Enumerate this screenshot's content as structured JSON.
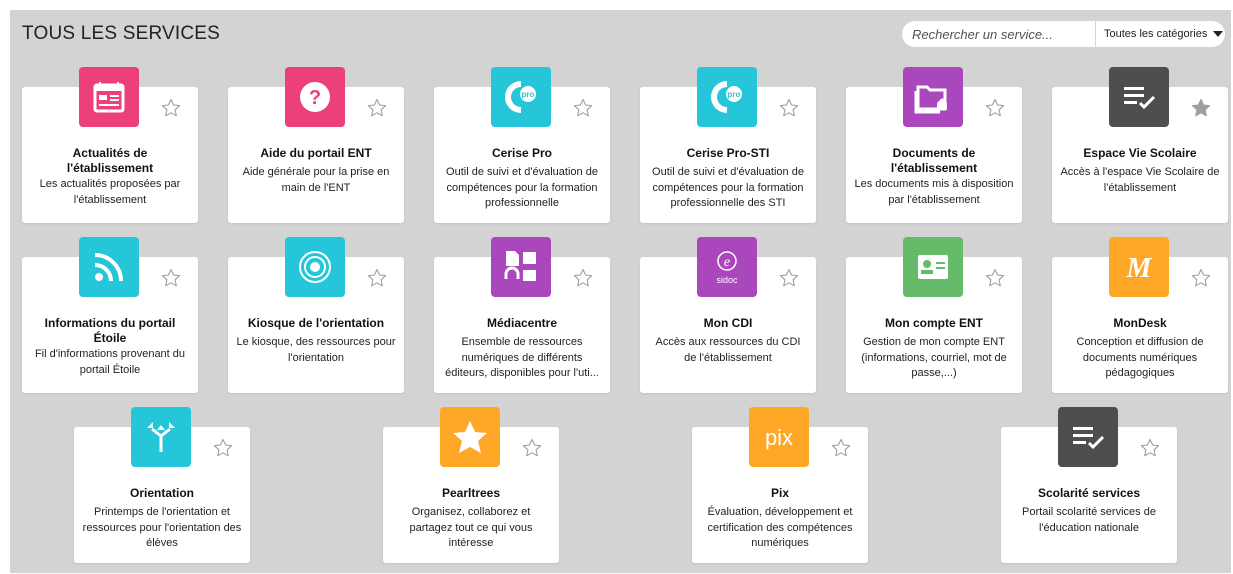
{
  "page": {
    "title": "TOUS LES SERVICES"
  },
  "search": {
    "placeholder": "Rechercher un service...",
    "category_label": "Toutes les catégories"
  },
  "colors": {
    "pink": "#ec407a",
    "cyan": "#26c6da",
    "purple": "#ab47bc",
    "dark": "#4e4e4e",
    "green": "#66bb6a",
    "orange": "#ffa726",
    "star_outline": "#9e9e9e",
    "star_filled": "#9e9e9e"
  },
  "services": [
    {
      "title": "Actualités de l'établissement",
      "description": "Les actualités proposées par l'établissement",
      "icon": "newspaper-icon",
      "color": "#ec407a",
      "favorite": false
    },
    {
      "title": "Aide du portail ENT",
      "description": "Aide générale pour la prise en main de l'ENT",
      "icon": "help-icon",
      "color": "#ec407a",
      "favorite": false
    },
    {
      "title": "Cerise Pro",
      "description": "Outil de suivi et d'évaluation de compétences pour la formation professionnelle",
      "icon": "cerise-pro-icon",
      "color": "#26c6da",
      "favorite": false
    },
    {
      "title": "Cerise Pro-STI",
      "description": "Outil de suivi et d'évaluation de compétences pour la formation professionnelle des STI",
      "icon": "cerise-pro-icon",
      "color": "#26c6da",
      "favorite": false
    },
    {
      "title": "Documents de l'établissement",
      "description": "Les documents mis à disposition par l'établissement",
      "icon": "folder-home-icon",
      "color": "#ab47bc",
      "favorite": false
    },
    {
      "title": "Espace Vie Scolaire",
      "description": "Accès à l'espace Vie Scolaire de l'établissement",
      "icon": "checklist-icon",
      "color": "#4e4e4e",
      "favorite": true
    },
    {
      "title": "Informations du portail Étoile",
      "description": "Fil d'informations provenant du portail Étoile",
      "icon": "rss-icon",
      "color": "#26c6da",
      "favorite": false
    },
    {
      "title": "Kiosque de l'orientation",
      "description": "Le kiosque, des ressources pour l'orientation",
      "icon": "target-icon",
      "color": "#26c6da",
      "favorite": false
    },
    {
      "title": "Médiacentre",
      "description": "Ensemble de ressources numériques de différents éditeurs, disponibles pour l'uti...",
      "icon": "media-icon",
      "color": "#ab47bc",
      "favorite": false
    },
    {
      "title": "Mon CDI",
      "description": "Accès aux ressources du CDI de l'établissement",
      "icon": "sidoc-icon",
      "icon_text": "sidoc",
      "color": "#ab47bc",
      "favorite": false
    },
    {
      "title": "Mon compte ENT",
      "description": "Gestion de mon compte ENT (informations, courriel, mot de passe,...)",
      "icon": "id-card-icon",
      "color": "#66bb6a",
      "favorite": false
    },
    {
      "title": "MonDesk",
      "description": "Conception et diffusion de documents numériques pédagogiques",
      "icon": "mondesk-icon",
      "icon_text": "M",
      "color": "#ffa726",
      "favorite": false
    },
    {
      "title": "Orientation",
      "description": "Printemps de l'orientation et ressources pour l'orientation des élèves",
      "icon": "directions-icon",
      "color": "#26c6da",
      "favorite": false
    },
    {
      "title": "Pearltrees",
      "description": "Organisez, collaborez et partagez tout ce qui vous intéresse",
      "icon": "star-icon",
      "color": "#ffa726",
      "favorite": false
    },
    {
      "title": "Pix",
      "description": "Évaluation, développement et certification des compétences numériques",
      "icon": "pix-icon",
      "icon_text": "pix",
      "color": "#ffa726",
      "favorite": false
    },
    {
      "title": "Scolarité services",
      "description": "Portail scolarité services de l'éducation nationale",
      "icon": "checklist-icon",
      "color": "#4e4e4e",
      "favorite": false
    }
  ]
}
